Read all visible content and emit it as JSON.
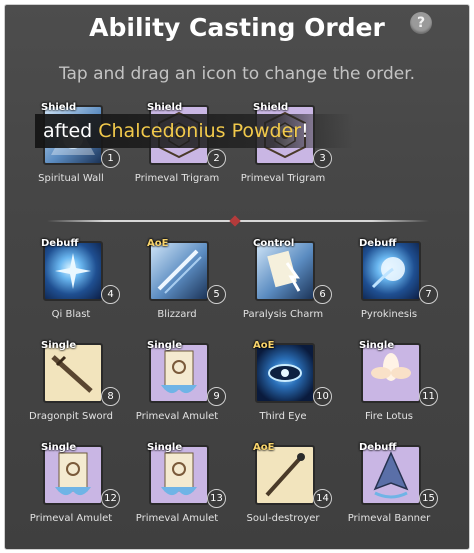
{
  "header": {
    "title": "Ability Casting Order",
    "help": "?",
    "subtitle": "Tap and drag an icon to change the order."
  },
  "toast": {
    "prefix": "afted ",
    "highlight": "Chalcedonius Powder",
    "suffix": "!"
  },
  "colors": {
    "panel": "#454545",
    "highlight": "#f1c94b",
    "divider_gem": "#b43b3b"
  },
  "slots": [
    {
      "tag": "Shield",
      "num": "1",
      "label": "Spiritual Wall",
      "icon": "spiritual-wall-icon"
    },
    {
      "tag": "Shield",
      "num": "2",
      "label": "Primeval Trigram",
      "icon": "primeval-trigram-icon"
    },
    {
      "tag": "Shield",
      "num": "3",
      "label": "Primeval Trigram",
      "icon": "primeval-trigram-icon"
    },
    {
      "tag": "Debuff",
      "num": "4",
      "label": "Qi Blast",
      "icon": "qi-blast-icon"
    },
    {
      "tag": "AoE",
      "num": "5",
      "label": "Blizzard",
      "icon": "blizzard-icon"
    },
    {
      "tag": "Control",
      "num": "6",
      "label": "Paralysis Charm",
      "icon": "paralysis-charm-icon"
    },
    {
      "tag": "Debuff",
      "num": "7",
      "label": "Pyrokinesis",
      "icon": "pyrokinesis-icon"
    },
    {
      "tag": "Single",
      "num": "8",
      "label": "Dragonpit Sword",
      "icon": "dragonpit-sword-icon"
    },
    {
      "tag": "Single",
      "num": "9",
      "label": "Primeval Amulet",
      "icon": "primeval-amulet-icon"
    },
    {
      "tag": "AoE",
      "num": "10",
      "label": "Third Eye",
      "icon": "third-eye-icon"
    },
    {
      "tag": "Single",
      "num": "11",
      "label": "Fire Lotus",
      "icon": "fire-lotus-icon"
    },
    {
      "tag": "Single",
      "num": "12",
      "label": "Primeval Amulet",
      "icon": "primeval-amulet-icon"
    },
    {
      "tag": "Single",
      "num": "13",
      "label": "Primeval Amulet",
      "icon": "primeval-amulet-icon"
    },
    {
      "tag": "AoE",
      "num": "14",
      "label": "Soul-destroyer",
      "icon": "soul-destroyer-icon"
    },
    {
      "tag": "Debuff",
      "num": "15",
      "label": "Primeval Banner",
      "icon": "primeval-banner-icon"
    }
  ]
}
